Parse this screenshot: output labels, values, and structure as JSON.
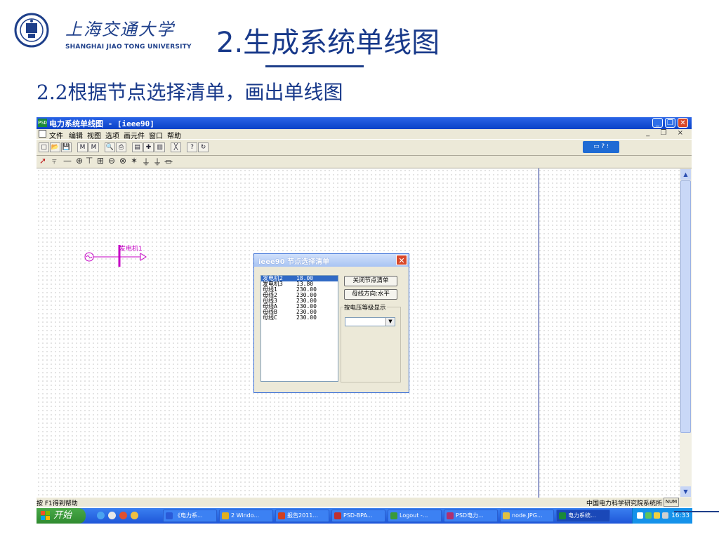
{
  "slide": {
    "university_cn": "上海交通大学",
    "university_en": "SHANGHAI JIAO TONG UNIVERSITY",
    "title": "2.生成系统单线图",
    "subtitle": "2.2根据节点选择清单，画出单线图"
  },
  "window": {
    "title": "电力系统单线图 - [ieee90]",
    "app_icon_text": "PSD",
    "controls": [
      "_",
      "❐",
      "✕"
    ],
    "mdi_controls": "_ ❐ ×"
  },
  "menu": [
    "文件",
    "编辑",
    "视图",
    "选项",
    "画元件",
    "窗口",
    "帮助"
  ],
  "toolbar1": {
    "buttons": [
      {
        "name": "new",
        "glyph": "□"
      },
      {
        "name": "open",
        "glyph": "📂"
      },
      {
        "name": "save",
        "glyph": "💾"
      },
      {
        "name": "find",
        "glyph": "M"
      },
      {
        "name": "find-next",
        "glyph": "M"
      },
      {
        "name": "print-preview",
        "glyph": "🔍"
      },
      {
        "name": "print",
        "glyph": "⎙"
      },
      {
        "name": "tool-a",
        "glyph": "▤"
      },
      {
        "name": "tool-b",
        "glyph": "✚"
      },
      {
        "name": "tool-c",
        "glyph": "▥"
      },
      {
        "name": "delete",
        "glyph": "╳"
      },
      {
        "name": "help",
        "glyph": "?"
      },
      {
        "name": "refresh",
        "glyph": "↻"
      }
    ],
    "widget_text": "▭ ? ⁝"
  },
  "toolbar2": {
    "symbols": [
      "➚",
      "⫧",
      "—",
      "⊕",
      "⊤",
      "⊞",
      "⊖",
      "⊗",
      "✶",
      "⏚",
      "⏚",
      "⏛"
    ]
  },
  "generator": {
    "label": "发电机1"
  },
  "dialog": {
    "title": "ieee90 节点选择清单",
    "nodes": [
      {
        "name": "发电机2",
        "kv": "18.00",
        "selected": true
      },
      {
        "name": "发电机3",
        "kv": "13.80",
        "selected": false
      },
      {
        "name": "母线1",
        "kv": "230.00",
        "selected": false
      },
      {
        "name": "母线2",
        "kv": "230.00",
        "selected": false
      },
      {
        "name": "母线3",
        "kv": "230.00",
        "selected": false
      },
      {
        "name": "母线A",
        "kv": "230.00",
        "selected": false
      },
      {
        "name": "母线B",
        "kv": "230.00",
        "selected": false
      },
      {
        "name": "母线C",
        "kv": "230.00",
        "selected": false
      }
    ],
    "close_list_button": "关闭节点清单",
    "bus_direction_button": "母线方向:水平",
    "voltage_group_label": "按电压等级显示",
    "voltage_select_value": ""
  },
  "statusbar": {
    "left": "按 F1得到帮助",
    "right": "中国电力科学研究院系统所",
    "num": "NUM"
  },
  "taskbar": {
    "start": "开始",
    "tasks": [
      {
        "label": "《电力系...",
        "color": "#2a5ad8"
      },
      {
        "label": "2 Windo...",
        "color": "#e0b020"
      },
      {
        "label": "报告2011...",
        "color": "#d04020"
      },
      {
        "label": "PSD-BPA...",
        "color": "#c03030"
      },
      {
        "label": "Logout -...",
        "color": "#3a9a3a"
      },
      {
        "label": "PSD电力...",
        "color": "#b03070"
      },
      {
        "label": "node.JPG...",
        "color": "#e0c040"
      },
      {
        "label": "电力系统...",
        "color": "#1a8a3a",
        "active": true
      }
    ],
    "clock": "16:33"
  }
}
